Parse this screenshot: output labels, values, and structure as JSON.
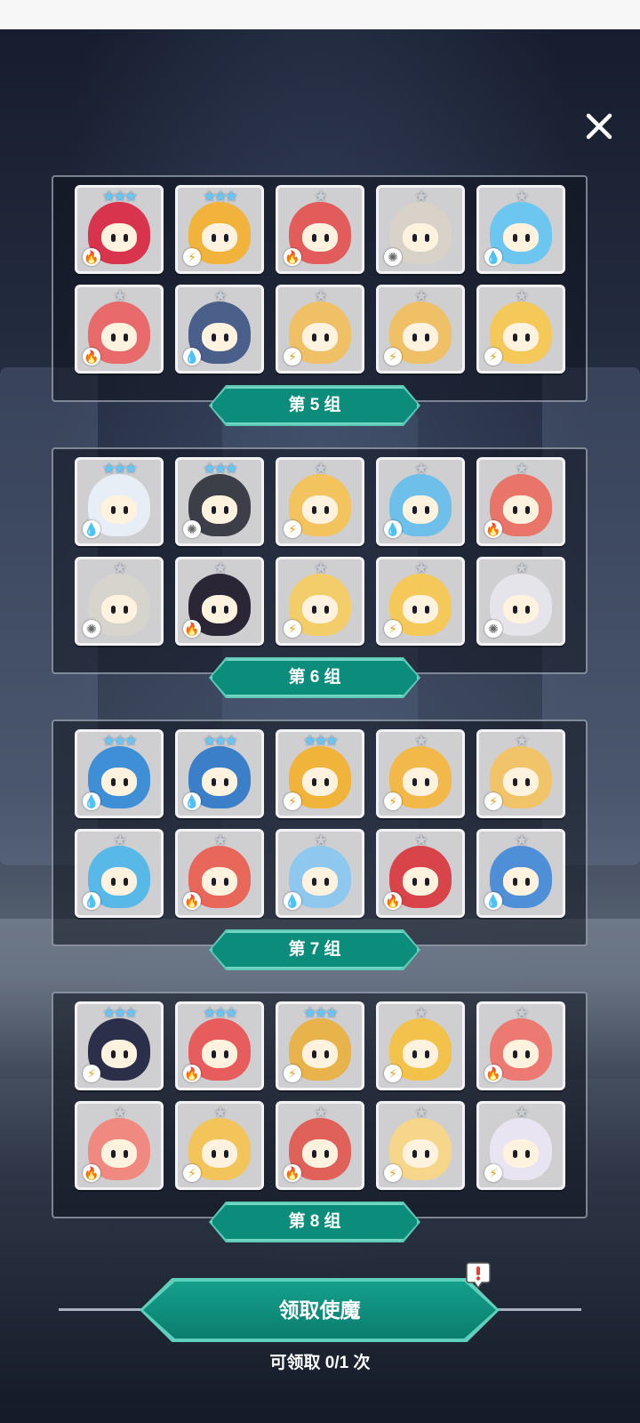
{
  "close_icon": "close-icon",
  "colors": {
    "accent": "#0c8c7b",
    "accent_border": "#5fc9b7",
    "panel_border": "#bec8d7"
  },
  "groups": [
    {
      "label": "第 5 组",
      "cards": [
        {
          "stars": "★★★",
          "star_color": "blue",
          "element": "fire",
          "color": "#d9344d"
        },
        {
          "stars": "★★★",
          "star_color": "blue",
          "element": "light",
          "color": "#f2b33d"
        },
        {
          "stars": "★",
          "star_color": "silver",
          "element": "fire",
          "color": "#e35c5c"
        },
        {
          "stars": "★",
          "star_color": "silver",
          "element": "wind",
          "color": "#d8d2c8"
        },
        {
          "stars": "★",
          "star_color": "silver",
          "element": "water",
          "color": "#6cc6f0"
        },
        {
          "stars": "★",
          "star_color": "silver",
          "element": "fire",
          "color": "#e86a6a"
        },
        {
          "stars": "★",
          "star_color": "silver",
          "element": "water",
          "color": "#4a5f8a"
        },
        {
          "stars": "★",
          "star_color": "silver",
          "element": "light",
          "color": "#f0c066"
        },
        {
          "stars": "★",
          "star_color": "silver",
          "element": "light",
          "color": "#f0c066"
        },
        {
          "stars": "★",
          "star_color": "silver",
          "element": "light",
          "color": "#f5c85a"
        }
      ]
    },
    {
      "label": "第 6 组",
      "cards": [
        {
          "stars": "★★★",
          "star_color": "blue",
          "element": "water",
          "color": "#e8eef5"
        },
        {
          "stars": "★★★",
          "star_color": "blue",
          "element": "wind",
          "color": "#3d3f48"
        },
        {
          "stars": "★",
          "star_color": "silver",
          "element": "light",
          "color": "#f3c35e"
        },
        {
          "stars": "★",
          "star_color": "silver",
          "element": "water",
          "color": "#6ec0ea"
        },
        {
          "stars": "★",
          "star_color": "silver",
          "element": "fire",
          "color": "#e9756a"
        },
        {
          "stars": "★",
          "star_color": "silver",
          "element": "wind",
          "color": "#d6d4cc"
        },
        {
          "stars": "★",
          "star_color": "silver",
          "element": "fire",
          "color": "#2b2636"
        },
        {
          "stars": "★",
          "star_color": "silver",
          "element": "light",
          "color": "#f3cd6a"
        },
        {
          "stars": "★",
          "star_color": "silver",
          "element": "light",
          "color": "#f5c85a"
        },
        {
          "stars": "★",
          "star_color": "silver",
          "element": "wind",
          "color": "#e4e4ea"
        }
      ]
    },
    {
      "label": "第 7 组",
      "cards": [
        {
          "stars": "★★★",
          "star_color": "blue",
          "element": "water",
          "color": "#3f8fd6"
        },
        {
          "stars": "★★★",
          "star_color": "blue",
          "element": "water",
          "color": "#3b7fc8"
        },
        {
          "stars": "★★★",
          "star_color": "blue",
          "element": "light",
          "color": "#f0b43a"
        },
        {
          "stars": "★",
          "star_color": "silver",
          "element": "light",
          "color": "#f3b84a"
        },
        {
          "stars": "★",
          "star_color": "silver",
          "element": "light",
          "color": "#f2c46a"
        },
        {
          "stars": "★",
          "star_color": "silver",
          "element": "water",
          "color": "#58b8e8"
        },
        {
          "stars": "★",
          "star_color": "silver",
          "element": "fire",
          "color": "#e9675a"
        },
        {
          "stars": "★",
          "star_color": "silver",
          "element": "water",
          "color": "#8fc8ef"
        },
        {
          "stars": "★",
          "star_color": "silver",
          "element": "fire",
          "color": "#d9434a"
        },
        {
          "stars": "★",
          "star_color": "silver",
          "element": "water",
          "color": "#4e8fd8"
        }
      ]
    },
    {
      "label": "第 8 组",
      "cards": [
        {
          "stars": "★★★",
          "star_color": "blue",
          "element": "light",
          "color": "#2c2f4a"
        },
        {
          "stars": "★★★",
          "star_color": "blue",
          "element": "fire",
          "color": "#e75c5c"
        },
        {
          "stars": "★★★",
          "star_color": "blue",
          "element": "light",
          "color": "#e8b34a"
        },
        {
          "stars": "★",
          "star_color": "silver",
          "element": "light",
          "color": "#f2c24a"
        },
        {
          "stars": "★",
          "star_color": "silver",
          "element": "fire",
          "color": "#ec7a72"
        },
        {
          "stars": "★",
          "star_color": "silver",
          "element": "fire",
          "color": "#f08a80"
        },
        {
          "stars": "★",
          "star_color": "silver",
          "element": "light",
          "color": "#f2c45a"
        },
        {
          "stars": "★",
          "star_color": "silver",
          "element": "fire",
          "color": "#e0605a"
        },
        {
          "stars": "★",
          "star_color": "silver",
          "element": "light",
          "color": "#f5d68a"
        },
        {
          "stars": "★",
          "star_color": "silver",
          "element": "light",
          "color": "#e9e4f2"
        }
      ]
    }
  ],
  "claim": {
    "button_label": "领取使魔",
    "count_text": "可领取 0/1 次"
  }
}
